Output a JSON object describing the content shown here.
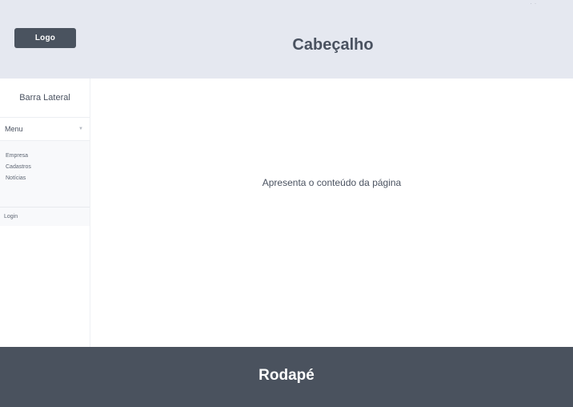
{
  "header": {
    "logo_label": "Logo",
    "title": "Cabeçalho",
    "corner_dots": "· ·"
  },
  "sidebar": {
    "title": "Barra Lateral",
    "menu_label": "Menu",
    "menu_icon": "chevron-down-icon",
    "items": [
      {
        "label": "Empresa"
      },
      {
        "label": "Cadastros"
      },
      {
        "label": "Notícias"
      }
    ],
    "login_label": "Login"
  },
  "main": {
    "content_text": "Apresenta o conteúdo da página"
  },
  "footer": {
    "title": "Rodapé"
  },
  "colors": {
    "header_bg": "#e5e8f0",
    "footer_bg": "#4a525e",
    "logo_bg": "#4a535f",
    "text": "#4a5260"
  }
}
